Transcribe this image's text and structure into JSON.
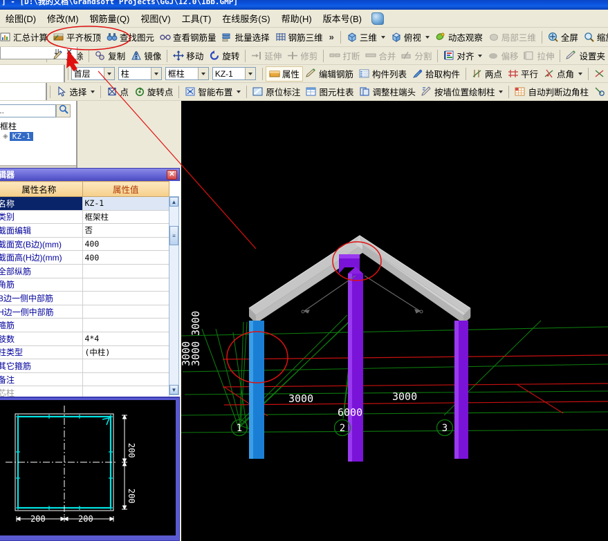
{
  "window": {
    "title": "] - [D:\\我的文档\\Grandsoft Projects\\GGJ\\12.0\\1bb.GMP]"
  },
  "menubar": {
    "items": [
      {
        "label": "绘图(D)",
        "name": "menu-draw"
      },
      {
        "label": "修改(M)",
        "name": "menu-modify"
      },
      {
        "label": "钢筋量(Q)",
        "name": "menu-rebar-quantity"
      },
      {
        "label": "视图(V)",
        "name": "menu-view"
      },
      {
        "label": "工具(T)",
        "name": "menu-tools"
      },
      {
        "label": "在线服务(S)",
        "name": "menu-online-service"
      },
      {
        "label": "帮助(H)",
        "name": "menu-help"
      },
      {
        "label": "版本号(B)",
        "name": "menu-version"
      }
    ]
  },
  "toolbar_main": {
    "left_partial": "汇总计算",
    "items": [
      {
        "label": "平齐板顶",
        "name": "flush-slab-top"
      },
      {
        "label": "查找图元",
        "name": "find-element"
      },
      {
        "label": "查看钢筋量",
        "name": "view-rebar-quantity"
      },
      {
        "label": "批量选择",
        "name": "batch-select"
      },
      {
        "label": "钢筋三维",
        "name": "rebar-3d"
      }
    ],
    "overflow_label": "»",
    "view_items": [
      {
        "label": "三维",
        "name": "view-3d",
        "dropdown": true,
        "disabled": false
      },
      {
        "label": "俯视",
        "name": "view-top",
        "dropdown": true,
        "disabled": false
      },
      {
        "label": "动态观察",
        "name": "dynamic-observe",
        "dropdown": false,
        "disabled": false
      },
      {
        "label": "局部三维",
        "name": "local-3d",
        "dropdown": false,
        "disabled": true
      },
      {
        "label": "全屏",
        "name": "fullscreen",
        "dropdown": false,
        "disabled": false
      },
      {
        "label": "缩放",
        "name": "zoom",
        "dropdown": true,
        "disabled": false
      }
    ]
  },
  "toolbar_edit": {
    "items": [
      {
        "label": "删除",
        "name": "delete",
        "disabled": false
      },
      {
        "label": "复制",
        "name": "copy",
        "disabled": false
      },
      {
        "label": "镜像",
        "name": "mirror",
        "disabled": false
      },
      {
        "label": "移动",
        "name": "move",
        "disabled": false
      },
      {
        "label": "旋转",
        "name": "rotate",
        "disabled": false
      },
      {
        "label": "延伸",
        "name": "extend",
        "disabled": true
      },
      {
        "label": "修剪",
        "name": "trim",
        "disabled": true
      },
      {
        "label": "打断",
        "name": "break",
        "disabled": true
      },
      {
        "label": "合并",
        "name": "merge",
        "disabled": true
      },
      {
        "label": "分割",
        "name": "split",
        "disabled": true
      },
      {
        "label": "对齐",
        "name": "align",
        "disabled": false,
        "dropdown": true
      },
      {
        "label": "偏移",
        "name": "offset",
        "disabled": true
      },
      {
        "label": "拉伸",
        "name": "stretch",
        "disabled": true
      },
      {
        "label": "设置夹",
        "name": "set-grip",
        "disabled": false
      }
    ]
  },
  "toolbar_select": {
    "combos": [
      {
        "name": "floor-combo",
        "value": "首层"
      },
      {
        "name": "component-type-combo",
        "value": "柱"
      },
      {
        "name": "component-subtype-combo",
        "value": "框柱"
      },
      {
        "name": "component-name-combo",
        "value": "KZ-1"
      }
    ],
    "items": [
      {
        "label": "属性",
        "name": "properties",
        "active": true
      },
      {
        "label": "编辑钢筋",
        "name": "edit-rebar"
      },
      {
        "label": "构件列表",
        "name": "component-list"
      },
      {
        "label": "拾取构件",
        "name": "pick-component"
      },
      {
        "label": "两点",
        "name": "two-point"
      },
      {
        "label": "平行",
        "name": "parallel"
      },
      {
        "label": "点角",
        "name": "point-angle",
        "dropdown": true
      }
    ]
  },
  "toolbar_draw": {
    "items": [
      {
        "label": "选择",
        "name": "select-tool",
        "dropdown": true
      },
      {
        "label": "点",
        "name": "point-tool"
      },
      {
        "label": "旋转点",
        "name": "rotate-point-tool"
      },
      {
        "label": "智能布置",
        "name": "smart-layout",
        "dropdown": true
      },
      {
        "label": "原位标注",
        "name": "in-situ-annotation"
      },
      {
        "label": "图元柱表",
        "name": "element-column-table"
      },
      {
        "label": "调整柱端头",
        "name": "adjust-column-end"
      },
      {
        "label": "按墙位置绘制柱",
        "name": "draw-column-by-wall",
        "dropdown": true
      },
      {
        "label": "自动判断边角柱",
        "name": "auto-detect-corner-column"
      }
    ]
  },
  "navigator": {
    "search_value": "...",
    "search_icon": "search-icon",
    "tree": {
      "parent": "框柱",
      "child": "KZ-1"
    }
  },
  "property_editor": {
    "title": "辑器",
    "close_label": "✕",
    "headers": [
      "属性名称",
      "属性值"
    ],
    "rows": [
      {
        "key": "名称",
        "value": "KZ-1",
        "selected": true
      },
      {
        "key": "类别",
        "value": "框架柱"
      },
      {
        "key": "截面编辑",
        "value": "否"
      },
      {
        "key": "截面宽(B边)(mm)",
        "value": "400"
      },
      {
        "key": "截面高(H边)(mm)",
        "value": "400"
      },
      {
        "key": "全部纵筋",
        "value": ""
      },
      {
        "key": "角筋",
        "value": ""
      },
      {
        "key": "B边一侧中部筋",
        "value": ""
      },
      {
        "key": "H边一侧中部筋",
        "value": ""
      },
      {
        "key": "箍筋",
        "value": ""
      },
      {
        "key": "肢数",
        "value": "4*4"
      },
      {
        "key": "柱类型",
        "value": "(中柱)"
      },
      {
        "key": "其它箍筋",
        "value": ""
      },
      {
        "key": "备注",
        "value": ""
      },
      {
        "key": "芯柱",
        "value": "",
        "dim": true
      }
    ]
  },
  "section_view": {
    "dim_top": "200",
    "dim_bottom": "200",
    "dim_left": "200",
    "dim_right": "200",
    "outline_color": "#00e5e5"
  },
  "viewport3d": {
    "axis_labels": [
      "1",
      "2",
      "3"
    ],
    "horizontal_dims": [
      "3000",
      "3000"
    ],
    "total_dim": "6000",
    "vertical_dims": [
      "3000",
      "3000",
      "3000"
    ],
    "colors": {
      "selected_column": "#1a7fd4",
      "column": "#7a13d8",
      "slab": "#bdbdbd",
      "grid_green": "#0d7a0d",
      "beam_red": "#c81010",
      "annotation_red": "#e01010"
    }
  }
}
